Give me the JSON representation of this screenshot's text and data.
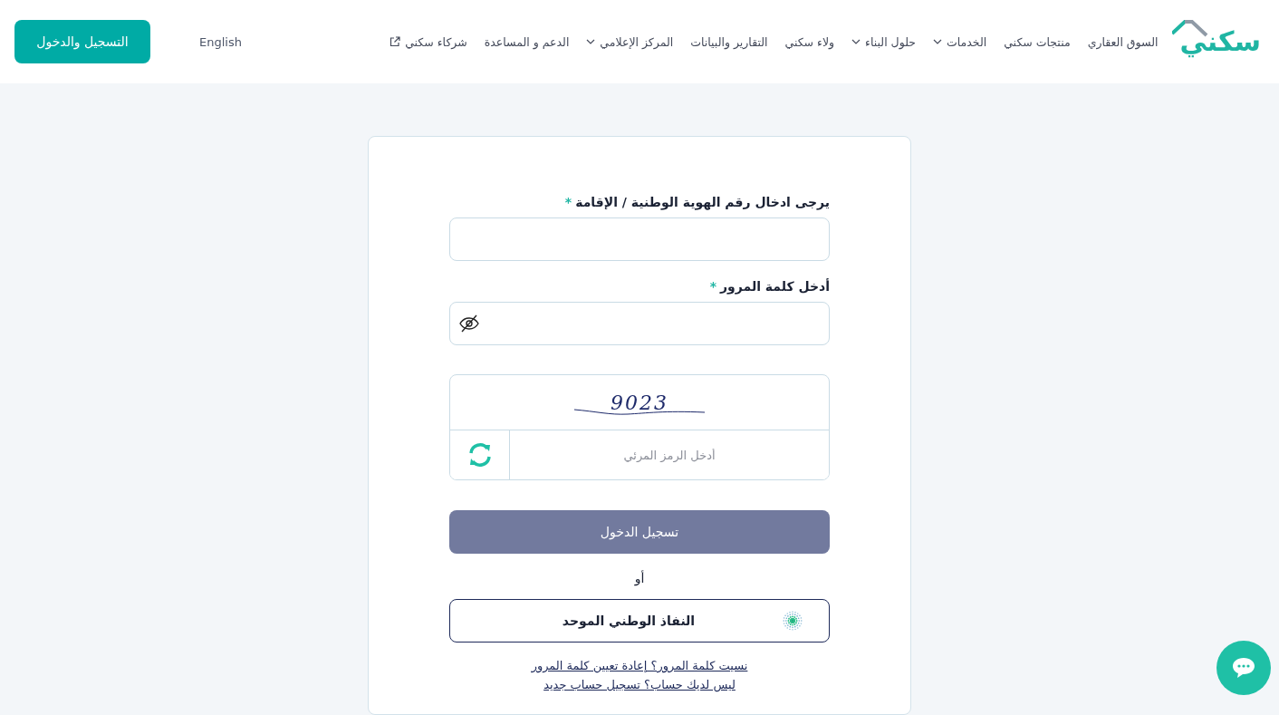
{
  "header": {
    "logo": "سكني",
    "nav": [
      {
        "label": "السوق العقاري",
        "kind": "link"
      },
      {
        "label": "منتجات سكني",
        "kind": "link"
      },
      {
        "label": "الخدمات",
        "kind": "dropdown"
      },
      {
        "label": "حلول البناء",
        "kind": "dropdown"
      },
      {
        "label": "ولاء سكني",
        "kind": "link"
      },
      {
        "label": "التقارير والبيانات",
        "kind": "link"
      },
      {
        "label": "المركز الإعلامي",
        "kind": "dropdown"
      },
      {
        "label": "الدعم و المساعدة",
        "kind": "link"
      },
      {
        "label": "شركاء سكني",
        "kind": "external"
      }
    ],
    "language": "English",
    "register_button": "التسجيل والدخول"
  },
  "form": {
    "id_field": {
      "label": "يرجى ادخال رقم الهوية الوطنية / الإقامة",
      "required_mark": "*"
    },
    "password_field": {
      "label": "أدخل كلمة المرور",
      "required_mark": "*"
    },
    "captcha": {
      "code": "9023",
      "placeholder": "أدخل الرمز المرئي"
    },
    "submit_button": {
      "label": "تسجيل الدخول",
      "disabled": true
    },
    "separator": "أو",
    "nafath_button": "النفاذ الوطني الموحد",
    "links": [
      "نسيت كلمة المرور؟ إعادة تعيين كلمة المرور",
      "ليس لديك حساب؟ تسجيل حساب جديد"
    ]
  }
}
